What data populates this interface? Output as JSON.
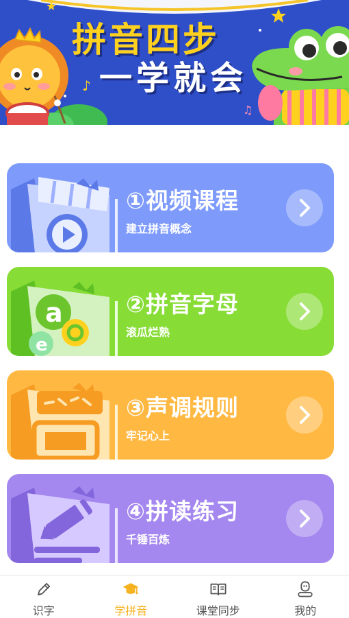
{
  "banner": {
    "title_line1": "拼音四步",
    "title_line2": "一学就会"
  },
  "cards": [
    {
      "title": "①视频课程",
      "subtitle": "建立拼音概念",
      "color": "#7e9bfb",
      "icon": "video-book-icon"
    },
    {
      "title": "②拼音字母",
      "subtitle": "滚瓜烂熟",
      "color": "#87dc36",
      "icon": "letters-book-icon"
    },
    {
      "title": "③声调规则",
      "subtitle": "牢记心上",
      "color": "#ffb943",
      "icon": "tone-book-icon"
    },
    {
      "title": "④拼读练习",
      "subtitle": "千锤百炼",
      "color": "#a487ef",
      "icon": "pencil-book-icon"
    }
  ],
  "tabbar": {
    "items": [
      {
        "label": "识字",
        "icon": "pencil-icon",
        "active": false
      },
      {
        "label": "学拼音",
        "icon": "graduation-cap-icon",
        "active": true
      },
      {
        "label": "课堂同步",
        "icon": "open-book-icon",
        "active": false
      },
      {
        "label": "我的",
        "icon": "profile-icon",
        "active": false
      }
    ],
    "active_color": "#f5b11e",
    "inactive_color": "#555555"
  }
}
